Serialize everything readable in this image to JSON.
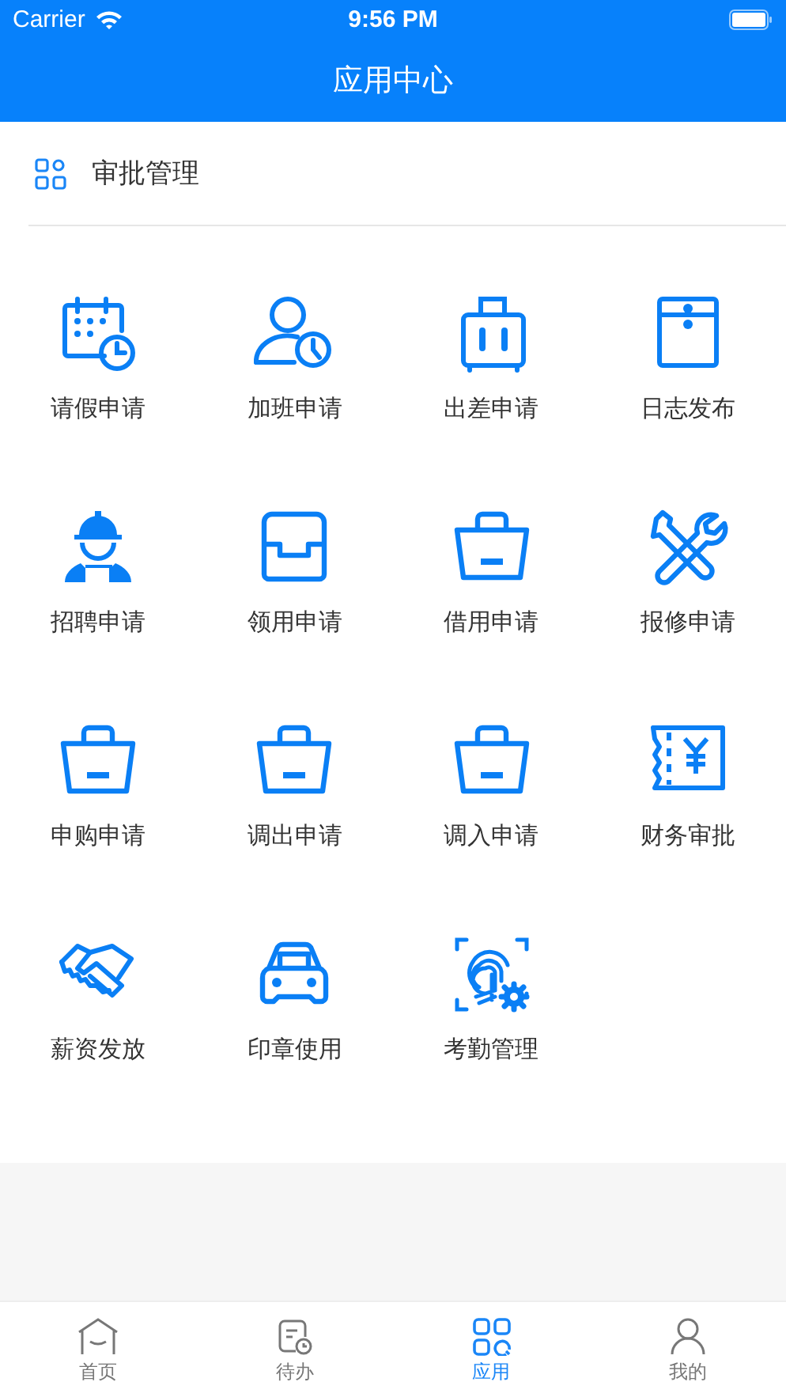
{
  "status_bar": {
    "carrier": "Carrier",
    "time": "9:56 PM"
  },
  "nav": {
    "title": "应用中心"
  },
  "section": {
    "title": "审批管理"
  },
  "apps": [
    {
      "label": "请假申请",
      "kind": "calendar"
    },
    {
      "label": "加班申请",
      "kind": "person-clock"
    },
    {
      "label": "出差申请",
      "kind": "suitcase"
    },
    {
      "label": "日志发布",
      "kind": "envelope"
    },
    {
      "label": "招聘申请",
      "kind": "worker"
    },
    {
      "label": "领用申请",
      "kind": "tray"
    },
    {
      "label": "借用申请",
      "kind": "bag"
    },
    {
      "label": "报修申请",
      "kind": "tools"
    },
    {
      "label": "申购申请",
      "kind": "bag"
    },
    {
      "label": "调出申请",
      "kind": "bag"
    },
    {
      "label": "调入申请",
      "kind": "bag"
    },
    {
      "label": "财务审批",
      "kind": "receipt"
    },
    {
      "label": "薪资发放",
      "kind": "handshake"
    },
    {
      "label": "印章使用",
      "kind": "car"
    },
    {
      "label": "考勤管理",
      "kind": "fingerprint"
    }
  ],
  "tabs": [
    {
      "label": "首页",
      "kind": "home",
      "selected": false
    },
    {
      "label": "待办",
      "kind": "todo",
      "selected": false
    },
    {
      "label": "应用",
      "kind": "apps",
      "selected": true
    },
    {
      "label": "我的",
      "kind": "profile",
      "selected": false
    }
  ]
}
